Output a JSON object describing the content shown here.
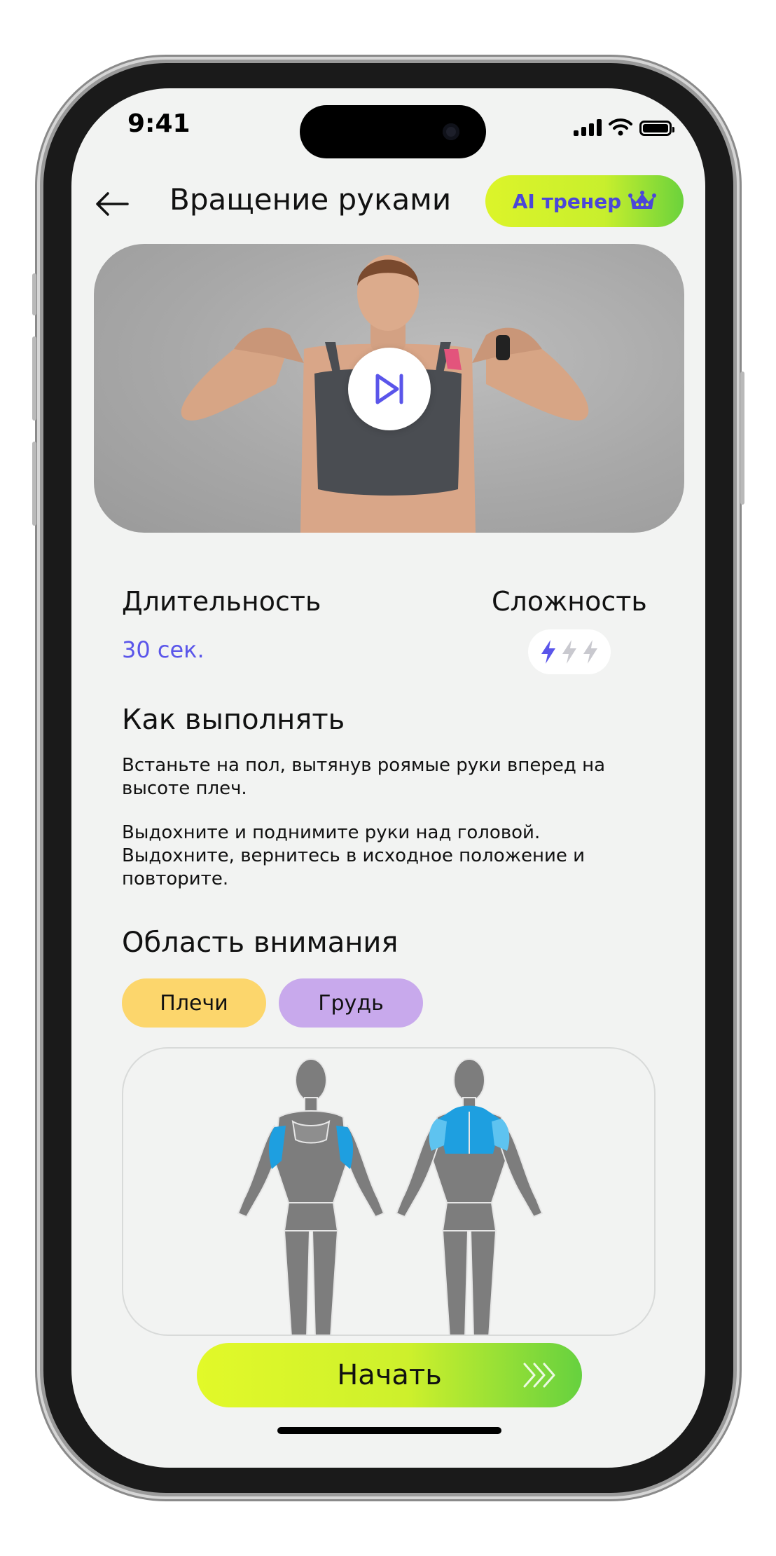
{
  "status_bar": {
    "time": "9:41",
    "icons": [
      "signal-icon",
      "wifi-icon",
      "battery-icon"
    ]
  },
  "header": {
    "back_icon": "arrow-left-icon",
    "title": "Вращение руками",
    "ai_button": {
      "label": "AI тренер",
      "icon": "crown-icon"
    }
  },
  "video": {
    "play_icon": "play-skip-icon"
  },
  "stats": {
    "duration_label": "Длительность",
    "duration_value": "30 сек.",
    "difficulty_label": "Сложность",
    "difficulty_level": 1,
    "difficulty_max": 3,
    "difficulty_icon": "lightning-icon"
  },
  "how_to": {
    "heading": "Как выполнять",
    "paragraphs": [
      "Встаньте на пол, вытянув роямые руки вперед на высоте плеч.",
      "Выдохните и поднимите руки над головой. Выдохните, вернитесь в исходное положение и повторите."
    ]
  },
  "focus": {
    "heading": "Область внимания",
    "chips": [
      "Плечи",
      "Грудь"
    ]
  },
  "start_button": {
    "label": "Начать",
    "icon": "chevrons-right-icon"
  },
  "colors": {
    "accent_purple": "#5a55ea",
    "lime": "#dcf42a",
    "green": "#66d13f",
    "chip_yellow": "#fcd66c",
    "chip_purple": "#c8a9ec",
    "muscle_highlight": "#1e9fe0"
  }
}
